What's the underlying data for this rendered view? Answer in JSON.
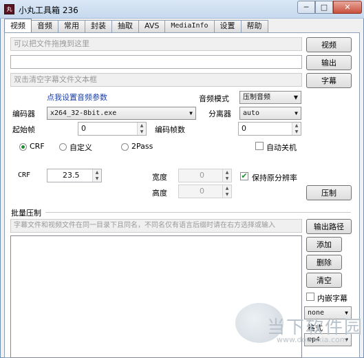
{
  "window": {
    "title": "小丸工具箱 236",
    "icon_text": "丸",
    "minimize": "─",
    "maximize": "□",
    "close": "✕"
  },
  "tabs": [
    "视频",
    "音频",
    "常用",
    "封装",
    "抽取",
    "AVS",
    "MediaInfo",
    "设置",
    "帮助"
  ],
  "inputs": {
    "video_drop": "可以把文件拖拽到这里",
    "output_path": "",
    "subtitle_drop": "双击清空字幕文件文本框"
  },
  "buttons": {
    "video": "视频",
    "output": "输出",
    "subtitle": "字幕",
    "compress": "压制",
    "out_path": "输出路径",
    "add": "添加",
    "delete": "删除",
    "clear": "清空"
  },
  "audio": {
    "link": "点我设置音频参数",
    "mode_label": "音频模式",
    "mode_value": "压制音频",
    "splitter_label": "分离器",
    "splitter_value": "auto"
  },
  "encoder": {
    "label": "编码器",
    "value": "x264_32-8bit.exe"
  },
  "frames": {
    "start_label": "起始帧",
    "start_value": "0",
    "count_label": "编码帧数",
    "count_value": "0"
  },
  "mode": {
    "crf": "CRF",
    "custom": "自定义",
    "twopass": "2Pass",
    "shutdown": "自动关机"
  },
  "crf": {
    "label": "CRF",
    "value": "23.5"
  },
  "resolution": {
    "width_label": "宽度",
    "width_value": "0",
    "height_label": "高度",
    "height_value": "0",
    "keep_label": "保持原分辨率"
  },
  "batch": {
    "title": "批量压制",
    "hint": "字幕文件和视频文件在同一目录下且同名，不同名仅有语言后缀时请在右方选择或输入",
    "embed_label": "内嵌字幕",
    "lang_value": "none",
    "format_label": "格式",
    "format_value": "mp4"
  },
  "watermark": {
    "text": "当下软件园",
    "url": "www.downxia.com"
  }
}
